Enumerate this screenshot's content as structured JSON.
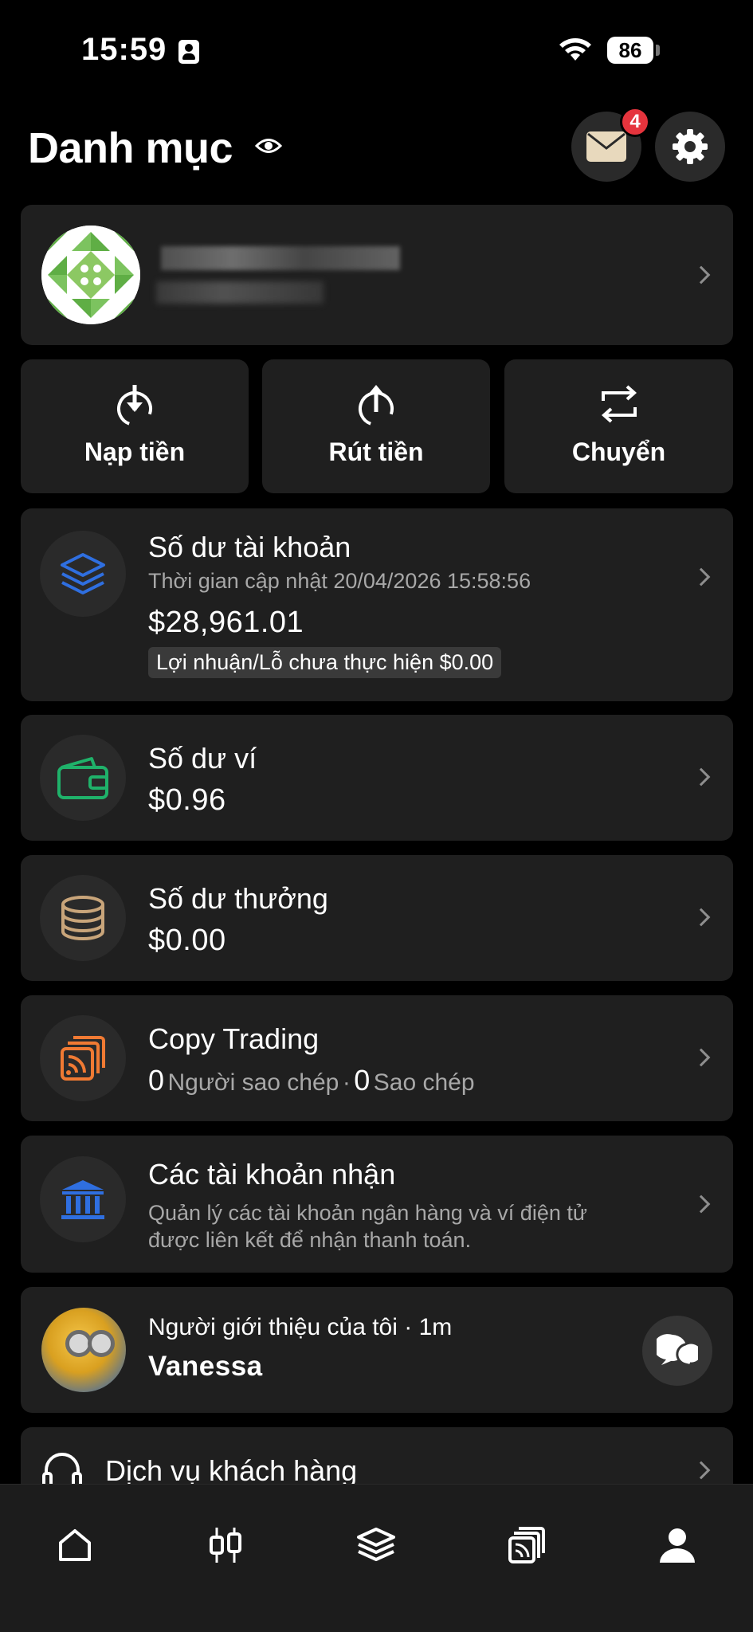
{
  "status_bar": {
    "time": "15:59",
    "battery": "86"
  },
  "header": {
    "title": "Danh mục",
    "mail_badge": "4"
  },
  "actions": [
    {
      "label": "Nạp tiền",
      "icon": "deposit-icon"
    },
    {
      "label": "Rút tiền",
      "icon": "withdraw-icon"
    },
    {
      "label": "Chuyển",
      "icon": "transfer-icon"
    }
  ],
  "balance": {
    "title": "Số dư tài khoản",
    "updated": "Thời gian cập nhật 20/04/2026 15:58:56",
    "amount": "$28,961.01",
    "unrealized": "Lợi nhuận/Lỗ chưa thực hiện $0.00"
  },
  "wallet": {
    "title": "Số dư ví",
    "amount": "$0.96"
  },
  "bonus": {
    "title": "Số dư thưởng",
    "amount": "$0.00"
  },
  "copy_trading": {
    "title": "Copy Trading",
    "copiers_count": "0",
    "copiers_label": "Người sao chép",
    "separator": "·",
    "copies_count": "0",
    "copies_label": "Sao chép"
  },
  "receiving_accounts": {
    "title": "Các tài khoản nhận",
    "desc_line1": "Quản lý các tài khoản ngân hàng và ví điện tử",
    "desc_line2": "được liên kết để nhận thanh toán."
  },
  "referrer": {
    "label": "Người giới thiệu của tôi · 1m",
    "name": "Vanessa"
  },
  "support": {
    "label": "Dịch vụ khách hàng"
  },
  "colors": {
    "layers": "#2f6fe0",
    "wallet": "#1fb26a",
    "coins": "#c9a57a",
    "copy": "#f07a33",
    "bank": "#2f6fe0",
    "badge": "#e5343d"
  },
  "tabs": [
    {
      "name": "home-icon"
    },
    {
      "name": "candlestick-icon"
    },
    {
      "name": "layers-icon"
    },
    {
      "name": "copy-trading-icon"
    },
    {
      "name": "profile-icon"
    }
  ]
}
